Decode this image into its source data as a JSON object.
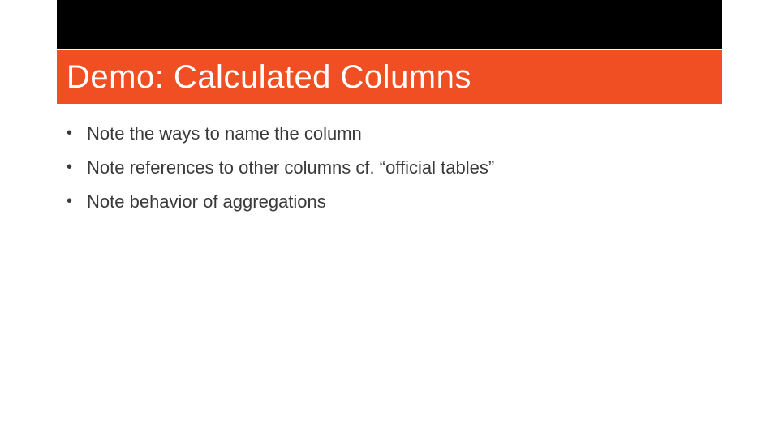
{
  "colors": {
    "accent": "#f04e23",
    "top_band": "#000000",
    "text": "#3a3a3a"
  },
  "slide": {
    "title": "Demo: Calculated Columns",
    "bullets": [
      "Note the ways to name the column",
      "Note references to other columns cf. “official tables”",
      "Note behavior of aggregations"
    ]
  }
}
